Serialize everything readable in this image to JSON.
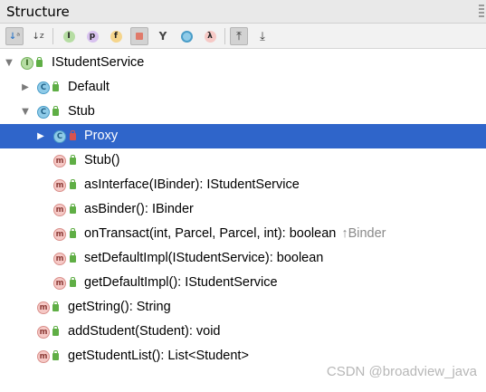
{
  "panel": {
    "title": "Structure"
  },
  "toolbar": {
    "buttons": [
      {
        "icon": "sort-by-visibility-icon",
        "glyph": "↓↕",
        "active": true
      },
      {
        "icon": "sort-alphabetically-icon",
        "glyph": "↓z",
        "active": false
      },
      {
        "icon": "show-inherited-icon",
        "glyph": "I",
        "active": false
      },
      {
        "icon": "show-properties-icon",
        "glyph": "p",
        "active": false
      },
      {
        "icon": "show-fields-icon",
        "glyph": "f",
        "active": false
      },
      {
        "icon": "show-non-public-icon",
        "glyph": "■",
        "active": true
      },
      {
        "icon": "show-anonymous-classes-icon",
        "glyph": "⭍",
        "active": false
      },
      {
        "icon": "show-lambdas-icon",
        "glyph": "○",
        "active": false
      },
      {
        "icon": "show-lambda-icon",
        "glyph": "λ",
        "active": false
      },
      {
        "icon": "expand-all-icon",
        "glyph": "⤒",
        "active": true
      },
      {
        "icon": "collapse-all-icon",
        "glyph": "⤓",
        "active": false
      }
    ]
  },
  "tree": {
    "root": {
      "label": "IStudentService"
    },
    "default_class": {
      "label": "Default"
    },
    "stub": {
      "label": "Stub"
    },
    "proxy": {
      "label": "Proxy"
    },
    "stub_ctor": {
      "label": "Stub()"
    },
    "as_interface": {
      "label": "asInterface(IBinder): IStudentService"
    },
    "as_binder": {
      "label": "asBinder(): IBinder"
    },
    "on_transact": {
      "label": "onTransact(int, Parcel, Parcel, int): boolean",
      "inherited": "↑Binder"
    },
    "set_default_impl": {
      "label": "setDefaultImpl(IStudentService): boolean"
    },
    "get_default_impl": {
      "label": "getDefaultImpl(): IStudentService"
    },
    "get_string": {
      "label": "getString(): String"
    },
    "add_student": {
      "label": "addStudent(Student): void"
    },
    "get_student_list": {
      "label": "getStudentList(): List<Student>"
    }
  },
  "watermark": "CSDN @broadview_java",
  "colors": {
    "selection": "#2f65ca",
    "method": "#f6c9c6",
    "class": "#8fcbe8",
    "interface": "#b6dda3"
  }
}
